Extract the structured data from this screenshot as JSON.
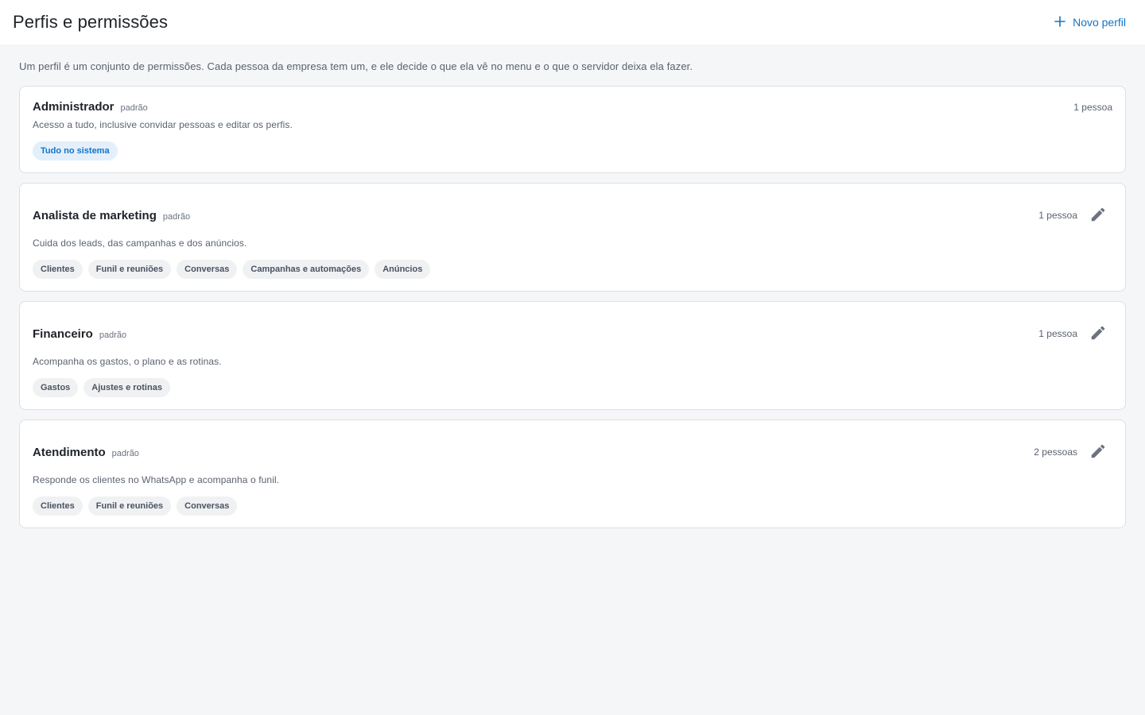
{
  "header": {
    "title": "Perfis e permissões",
    "new_button_label": "Novo perfil"
  },
  "intro": "Um perfil é um conjunto de permissões. Cada pessoa da empresa tem um, e ele decide o que ela vê no menu e o que o servidor deixa ela fazer.",
  "roles": [
    {
      "name": "Administrador",
      "tag": "padrão",
      "count": "1 pessoa",
      "description": "Acesso a tudo, inclusive convidar pessoas e editar os perfis.",
      "permissions": [
        "Tudo no sistema"
      ]
    },
    {
      "name": "Analista de marketing",
      "tag": "padrão",
      "count": "1 pessoa",
      "description": "Cuida dos leads, das campanhas e dos anúncios.",
      "permissions": [
        "Clientes",
        "Funil e reuniões",
        "Conversas",
        "Campanhas e automações",
        "Anúncios"
      ]
    },
    {
      "name": "Financeiro",
      "tag": "padrão",
      "count": "1 pessoa",
      "description": "Acompanha os gastos, o plano e as rotinas.",
      "permissions": [
        "Gastos",
        "Ajustes e rotinas"
      ]
    },
    {
      "name": "Atendimento",
      "tag": "padrão",
      "count": "2 pessoas",
      "description": "Responde os clientes no WhatsApp e acompanha o funil.",
      "permissions": [
        "Clientes",
        "Funil e reuniões",
        "Conversas"
      ]
    }
  ],
  "colors": {
    "accent": "#1473c4",
    "background": "#f5f6f8",
    "card_border": "#dcdfe4"
  },
  "icons": {
    "new": "plus-icon",
    "edit": "pencil-icon"
  }
}
